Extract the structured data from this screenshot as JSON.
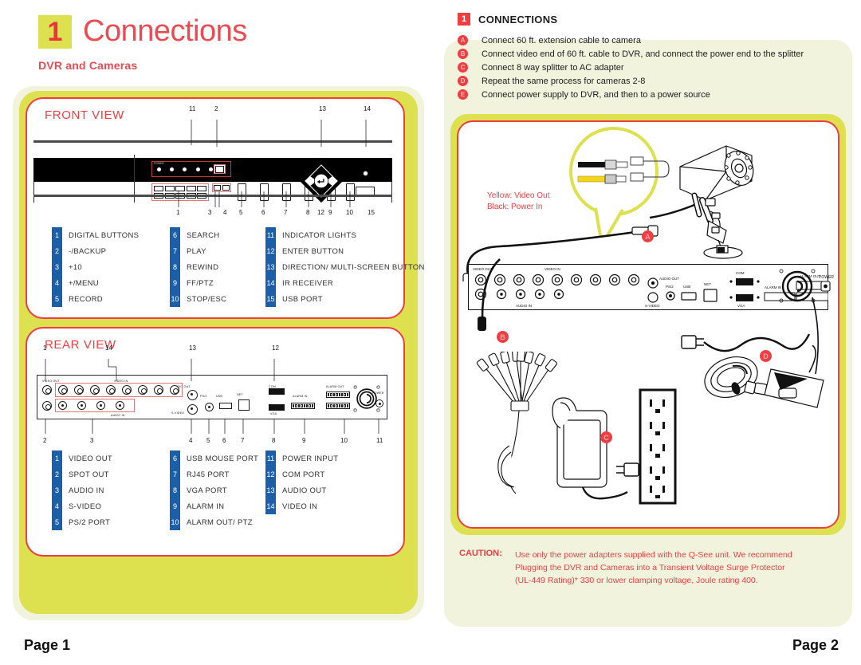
{
  "document": {
    "section_number": "1",
    "section_title": "Connections",
    "subtitle": "DVR and Cameras"
  },
  "left_page": {
    "front_view": {
      "heading": "FRONT VIEW",
      "panel_label": "POWER",
      "callout_numbers_top": [
        "2",
        "11",
        "13",
        "14"
      ],
      "callout_numbers_bottom": [
        "1",
        "3",
        "4",
        "5",
        "6",
        "7",
        "8",
        "9",
        "10",
        "12",
        "15"
      ],
      "legend": [
        [
          {
            "num": "1",
            "label": "DIGITAL BUTTONS"
          },
          {
            "num": "2",
            "label": "-/BACKUP"
          },
          {
            "num": "3",
            "label": "+10"
          },
          {
            "num": "4",
            "label": "+/MENU"
          },
          {
            "num": "5",
            "label": "RECORD"
          }
        ],
        [
          {
            "num": "6",
            "label": "SEARCH"
          },
          {
            "num": "7",
            "label": "PLAY"
          },
          {
            "num": "8",
            "label": "REWIND"
          },
          {
            "num": "9",
            "label": "FF/PTZ"
          },
          {
            "num": "10",
            "label": "STOP/ESC"
          }
        ],
        [
          {
            "num": "11",
            "label": "INDICATOR LIGHTS"
          },
          {
            "num": "12",
            "label": "ENTER BUTTON"
          },
          {
            "num": "13",
            "label": "DIRECTION/ MULTI-SCREEN BUTTON"
          },
          {
            "num": "14",
            "label": "IR RECEIVER"
          },
          {
            "num": "15",
            "label": "USB PORT"
          }
        ]
      ]
    },
    "rear_view": {
      "heading": "REAR VIEW",
      "port_labels": [
        "VIDEO OUT",
        "VIDEO IN",
        "AUDIO IN",
        "AUDIO OUT",
        "S-VIDEO",
        "PS/2",
        "USB",
        "NET",
        "COM",
        "VGA",
        "ALARM IN",
        "ALARM OUT",
        "POWER"
      ],
      "callout_numbers_top": [
        "1",
        "14",
        "13",
        "12"
      ],
      "callout_numbers_bottom": [
        "2",
        "3",
        "4",
        "5",
        "6",
        "7",
        "8",
        "9",
        "10",
        "11"
      ],
      "legend": [
        [
          {
            "num": "1",
            "label": "VIDEO OUT"
          },
          {
            "num": "2",
            "label": "SPOT OUT"
          },
          {
            "num": "3",
            "label": "AUDIO IN"
          },
          {
            "num": "4",
            "label": "S-VIDEO"
          },
          {
            "num": "5",
            "label": "PS/2 PORT"
          }
        ],
        [
          {
            "num": "6",
            "label": "USB MOUSE PORT"
          },
          {
            "num": "7",
            "label": "RJ45 PORT"
          },
          {
            "num": "8",
            "label": "VGA PORT"
          },
          {
            "num": "9",
            "label": "ALARM IN"
          },
          {
            "num": "10",
            "label": "ALARM OUT/ PTZ"
          }
        ],
        [
          {
            "num": "11",
            "label": "POWER INPUT"
          },
          {
            "num": "12",
            "label": "COM PORT"
          },
          {
            "num": "13",
            "label": "AUDIO OUT"
          },
          {
            "num": "14",
            "label": "VIDEO IN"
          }
        ]
      ]
    },
    "footer": "Page 1"
  },
  "right_page": {
    "badge": "1",
    "title": "CONNECTIONS",
    "steps": [
      {
        "marker": "A",
        "text": "Connect 60 ft. extension cable to camera"
      },
      {
        "marker": "B",
        "text": "Connect video end of 60 ft. cable to DVR, and connect the power end to the splitter"
      },
      {
        "marker": "C",
        "text": "Connect 8 way splitter to AC adapter"
      },
      {
        "marker": "D",
        "text": "Repeat the same process for cameras 2-8"
      },
      {
        "marker": "E",
        "text": "Connect power supply to DVR, and then to a power source"
      }
    ],
    "diagram": {
      "cable_note_line1": "Yellow: Video Out",
      "cable_note_line2": "Black: Power In",
      "markers": [
        "A",
        "B",
        "C",
        "D"
      ],
      "dvr_port_labels": [
        "VIDEO OUT",
        "VIDEO IN",
        "AUDIO IN",
        "AUDIO OUT",
        "S-VIDEO",
        "PS/2",
        "USB",
        "NET",
        "COM",
        "VGA",
        "ALARM IN",
        "ALARM OUT",
        "POWER"
      ]
    },
    "caution": {
      "label": "CAUTION:",
      "line1": "Use only the power adapters supplied with the Q-See unit. We recommend",
      "line2": "Plugging the DVR and Cameras into a Transient Voltage Surge Protector",
      "line3": "(UL-449 Rating)* 330 or lower clamping voltage, Joule rating 400."
    },
    "footer": "Page 2"
  },
  "colors": {
    "red": "#ef3e42",
    "green": "#dde04f",
    "cream": "#f1f3dc",
    "blue_badge": "#1b5fa8",
    "yellow_cable": "#f0d420"
  }
}
